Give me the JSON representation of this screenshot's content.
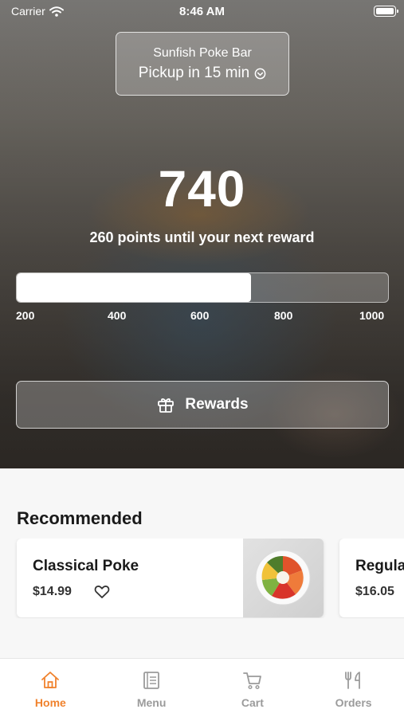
{
  "status_bar": {
    "carrier": "Carrier",
    "time": "8:46 AM"
  },
  "location": {
    "name": "Sunfish Poke Bar",
    "pickup": "Pickup in 15 min"
  },
  "loyalty": {
    "points": "740",
    "caption": "260 points until your next reward",
    "progress_fraction": 0.63,
    "ticks": [
      "200",
      "400",
      "600",
      "800",
      "1000"
    ]
  },
  "rewards_button": {
    "label": "Rewards"
  },
  "recommended": {
    "title": "Recommended",
    "items": [
      {
        "name": "Classical Poke",
        "price": "$14.99"
      },
      {
        "name": "Regular Poke",
        "price": "$16.05"
      }
    ]
  },
  "tabs": [
    {
      "label": "Home",
      "icon": "home-icon",
      "active": true
    },
    {
      "label": "Menu",
      "icon": "menu-icon",
      "active": false
    },
    {
      "label": "Cart",
      "icon": "cart-icon",
      "active": false
    },
    {
      "label": "Orders",
      "icon": "orders-icon",
      "active": false
    }
  ],
  "colors": {
    "accent": "#f0822d",
    "inactive_tab": "#9b9b9b"
  }
}
